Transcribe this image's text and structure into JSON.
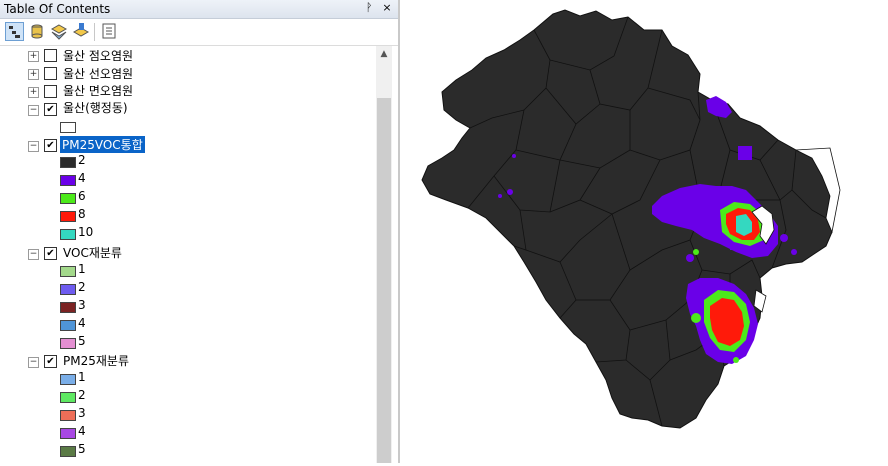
{
  "toc": {
    "title": "Table Of Contents",
    "pin_glyph": "ᚹ",
    "close_glyph": "×",
    "toolbar": [
      "list-by-drawing-order-icon",
      "list-by-source-icon",
      "list-by-visibility-icon",
      "list-by-selection-icon",
      "options-icon"
    ],
    "layers": [
      {
        "label": "울산 점오염원",
        "checked": false,
        "expanded": false
      },
      {
        "label": "울산 선오염원",
        "checked": false,
        "expanded": false
      },
      {
        "label": "울산 면오염원",
        "checked": false,
        "expanded": false
      },
      {
        "label": "울산(행정동)",
        "checked": true,
        "expanded": true
      },
      {
        "label": "PM25VOC통합",
        "checked": true,
        "expanded": true,
        "selected": true
      },
      {
        "label": "VOC재분류",
        "checked": true,
        "expanded": true
      },
      {
        "label": "PM25재분류",
        "checked": true,
        "expanded": true
      }
    ],
    "symbols": {
      "dong": {
        "color": "#ffffff"
      },
      "pm25voc": [
        {
          "label": "2",
          "color": "#2b2b2b"
        },
        {
          "label": "4",
          "color": "#6a00e8"
        },
        {
          "label": "6",
          "color": "#4cea1a"
        },
        {
          "label": "8",
          "color": "#ff1a0a"
        },
        {
          "label": "10",
          "color": "#34d8c0"
        }
      ],
      "voc": [
        {
          "label": "1",
          "color": "#a3d98b"
        },
        {
          "label": "2",
          "color": "#6e5cf0"
        },
        {
          "label": "3",
          "color": "#7b2323"
        },
        {
          "label": "4",
          "color": "#4f95d8"
        },
        {
          "label": "5",
          "color": "#e48fd2"
        }
      ],
      "pm25": [
        {
          "label": "1",
          "color": "#7aaee8"
        },
        {
          "label": "2",
          "color": "#5ee862"
        },
        {
          "label": "3",
          "color": "#ee6e58"
        },
        {
          "label": "4",
          "color": "#a848e4"
        },
        {
          "label": "5",
          "color": "#5a7a45"
        }
      ]
    }
  },
  "map": {
    "fill": "#2b2b2b",
    "border": "#111111"
  }
}
